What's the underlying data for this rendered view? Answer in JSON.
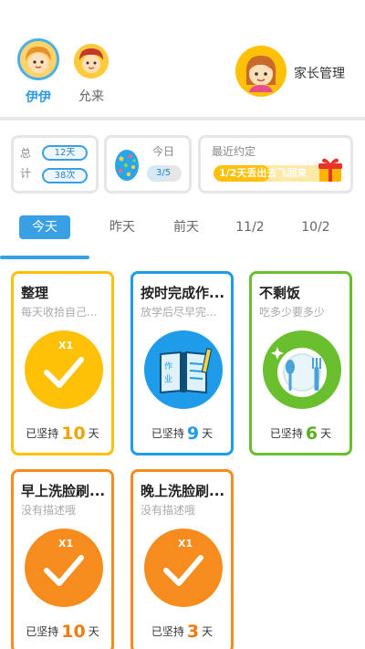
{
  "header": {
    "kids": [
      {
        "name": "伊伊",
        "selected": true
      },
      {
        "name": "允来",
        "selected": false
      }
    ],
    "parent_label": "家长管理"
  },
  "stats": {
    "total_label": "总计",
    "days": "12天",
    "times": "38次",
    "today_label": "今日",
    "today_ratio": "3/5",
    "today_progress": 0.6,
    "agreement_title": "最近约定",
    "agreement_text": "1/2天丢出去飞回来",
    "agreement_progress": 0.5
  },
  "tabs": [
    "今天",
    "昨天",
    "前天",
    "11/2",
    "10/2"
  ],
  "active_tab": 0,
  "footer_prefix": "已坚持",
  "footer_suffix": "天",
  "cards": [
    {
      "title": "整理",
      "desc": "每天收拾自己...",
      "days": "10",
      "color": "#ffc107",
      "num_color": "#f0a400",
      "icon": "check-icon",
      "badge": "X1"
    },
    {
      "title": "按时完成作...",
      "desc": "放学后尽早完...",
      "days": "9",
      "color": "#1e9be9",
      "num_color": "#1e9be9",
      "icon": "homework-book-icon",
      "badge": ""
    },
    {
      "title": "不剩饭",
      "desc": "吃多少要多少",
      "days": "6",
      "color": "#6abf2e",
      "num_color": "#5aaf22",
      "icon": "plate-cutlery-icon",
      "badge": ""
    },
    {
      "title": "早上洗脸刷...",
      "desc": "没有描述哦",
      "days": "10",
      "color": "#f68b1e",
      "num_color": "#f07b0e",
      "icon": "check-icon",
      "badge": "X1"
    },
    {
      "title": "晚上洗脸刷...",
      "desc": "没有描述哦",
      "days": "3",
      "color": "#f68b1e",
      "num_color": "#f07b0e",
      "icon": "check-icon",
      "badge": "X1"
    }
  ]
}
